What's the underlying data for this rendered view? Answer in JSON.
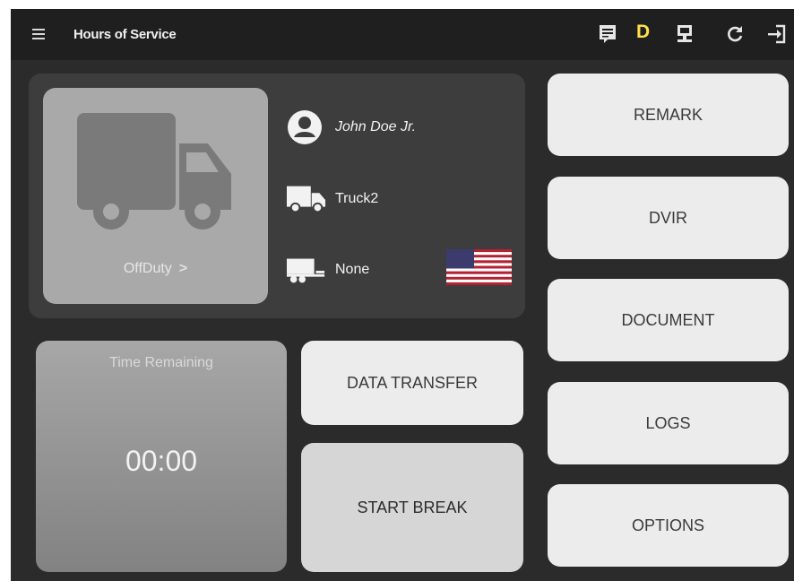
{
  "header": {
    "title": "Hours of Service",
    "duty_letter": "D"
  },
  "icons": {
    "menu": "menu-icon",
    "messages": "message-icon",
    "eld_connection": "eld-device-icon",
    "refresh": "refresh-icon",
    "logout": "logout-icon"
  },
  "driver": {
    "status": "OffDuty",
    "name": "John Doe Jr.",
    "vehicle": "Truck2",
    "trailer": "None",
    "country_flag": "us-flag-icon"
  },
  "timer": {
    "label": "Time Remaining",
    "value": "00:00"
  },
  "actions": {
    "data_transfer": "DATA TRANSFER",
    "start_break": "START BREAK"
  },
  "side_menu": {
    "remark": "REMARK",
    "dvir": "DVIR",
    "document": "DOCUMENT",
    "logs": "LOGS",
    "options": "OPTIONS"
  },
  "colors": {
    "app_background": "#2b2b2b",
    "top_bar": "#1f1f1f",
    "duty_accent": "#ffe14a",
    "button": "#ececec"
  }
}
